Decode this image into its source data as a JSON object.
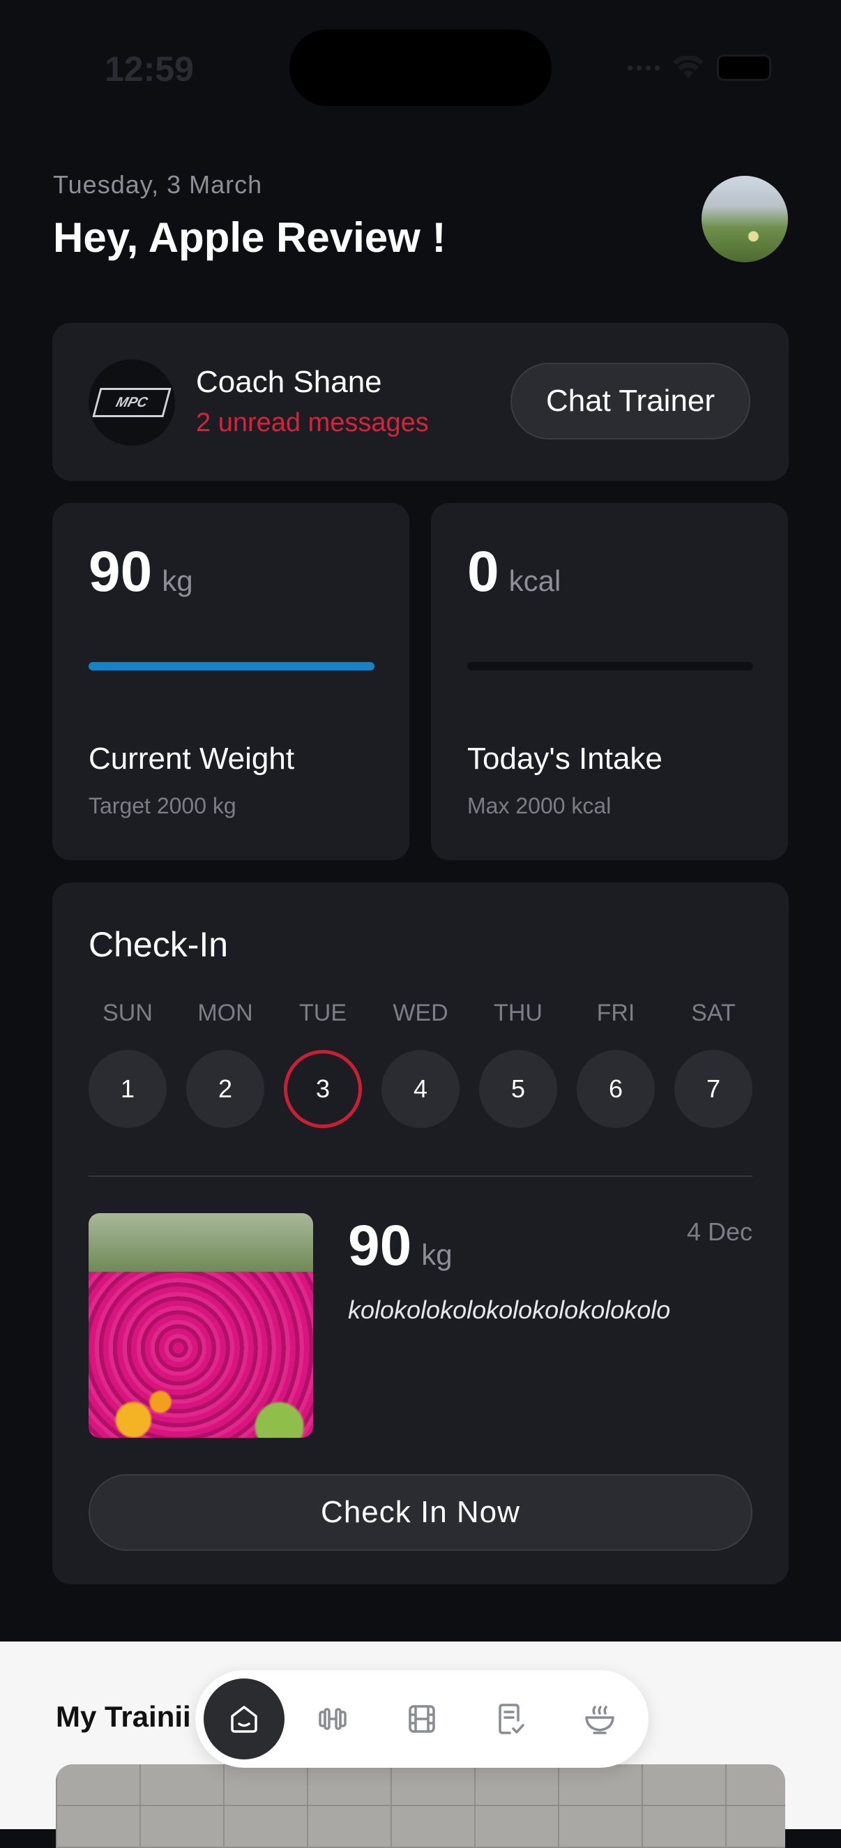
{
  "status": {
    "time": "12:59"
  },
  "header": {
    "date": "Tuesday, 3 March",
    "greeting": "Hey, Apple Review !"
  },
  "coach": {
    "name": "Coach Shane",
    "unread": "2 unread messages",
    "logo_text": "MPC",
    "chat_button": "Chat Trainer"
  },
  "stats": {
    "weight": {
      "value": "90",
      "unit": "kg",
      "label": "Current Weight",
      "sub": "Target 2000 kg",
      "progress": 1.0,
      "bar_color": "#1384c8"
    },
    "intake": {
      "value": "0",
      "unit": "kcal",
      "label": "Today's Intake",
      "sub": "Max 2000 kcal",
      "progress": 0.0
    }
  },
  "checkin": {
    "title": "Check-In",
    "days": [
      {
        "name": "SUN",
        "num": "1"
      },
      {
        "name": "MON",
        "num": "2"
      },
      {
        "name": "TUE",
        "num": "3",
        "today": true
      },
      {
        "name": "WED",
        "num": "4"
      },
      {
        "name": "THU",
        "num": "5"
      },
      {
        "name": "FRI",
        "num": "6"
      },
      {
        "name": "SAT",
        "num": "7"
      }
    ],
    "entry": {
      "value": "90",
      "unit": "kg",
      "date": "4 Dec",
      "note": "kolokolokolokolokolokolokolo"
    },
    "button": "Check In Now"
  },
  "training": {
    "title": "My Trainii"
  },
  "tabs": [
    {
      "icon": "home-icon",
      "active": true
    },
    {
      "icon": "dumbbell-icon"
    },
    {
      "icon": "film-icon"
    },
    {
      "icon": "checklist-icon"
    },
    {
      "icon": "bowl-icon"
    }
  ],
  "colors": {
    "accent_blue": "#1384c8",
    "accent_red": "#d4243b",
    "background": "#0d0e12",
    "card": "#1c1d22"
  }
}
